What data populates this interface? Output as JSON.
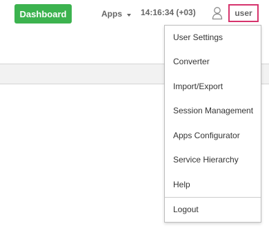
{
  "header": {
    "dashboard_label": "Dashboard",
    "apps_label": "Apps",
    "clock": "14:16:34 (+03)",
    "user_label": "user"
  },
  "user_menu": {
    "items": [
      {
        "label": "User Settings"
      },
      {
        "label": "Converter"
      },
      {
        "label": "Import/Export"
      },
      {
        "label": "Session Management"
      },
      {
        "label": "Apps Configurator"
      },
      {
        "label": "Service Hierarchy"
      },
      {
        "label": "Help"
      }
    ],
    "logout_label": "Logout"
  },
  "colors": {
    "dashboard_green": "#3cb34f",
    "user_outline_pink": "#d6336c"
  },
  "icons": {
    "apps_caret": "caret-down-icon",
    "user": "user-outline-icon"
  }
}
